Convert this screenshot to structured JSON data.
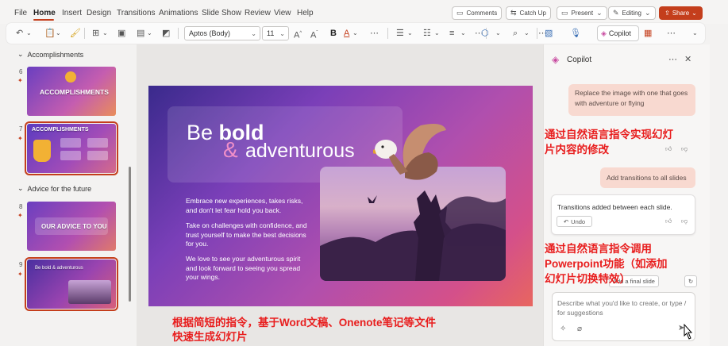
{
  "menu": [
    "File",
    "Home",
    "Insert",
    "Design",
    "Transitions",
    "Animations",
    "Slide Show",
    "Review",
    "View",
    "Help"
  ],
  "top_buttons": {
    "comments": "Comments",
    "catchup": "Catch Up",
    "present": "Present",
    "editing": "Editing",
    "share": "Share"
  },
  "toolbar": {
    "font_name": "Aptos (Body)",
    "font_size": "11",
    "copilot": "Copilot"
  },
  "thumbnails": {
    "section1": "Accomplishments",
    "section2": "Advice for the future",
    "slides": [
      {
        "num": "6",
        "title": "ACCOMPLISHMENTS"
      },
      {
        "num": "7",
        "title": "ACCOMPLISHMENTS"
      },
      {
        "num": "8",
        "title": "OUR ADVICE TO YOU"
      },
      {
        "num": "9",
        "title": "Be bold & adventurous"
      }
    ]
  },
  "slide": {
    "line1_plain": "Be ",
    "line1_bold": "bold",
    "amp": "&",
    "line2": "adventurous",
    "para1": "Embrace new experiences, takes risks, and don't let fear hold you back.",
    "para2": "Take on challenges with confidence, and trust yourself to make the best decisions for you.",
    "para3": "We love to see your adventurous spirit and look forward to seeing you spread your wings."
  },
  "copilot": {
    "title": "Copilot",
    "bubble1": "Replace the image with one that goes with adventure or flying",
    "bubble2": "Add transitions to all slides",
    "response": "Transitions added between each slide.",
    "undo": "Undo",
    "chip1": "Add a final slide",
    "input_placeholder": "Describe what you'd like to create, or type / for suggestions"
  },
  "annotations": {
    "a1": "通过自然语言指令实现幻灯片内容的修改",
    "a1_line1": "通过自然语言指令实现幻灯",
    "a1_line2": "片内容的修改",
    "a2_line1": "通过自然语言指令调用",
    "a2_line2": "Powerpoint功能（如添加",
    "a2_line3": "幻灯片切换特效）",
    "a3_line1": "根据简短的指令，基于Word文稿、Onenote笔记等文件",
    "a3_line2": "快速生成幻灯片"
  },
  "colors": {
    "accent": "#c43e1c",
    "annotation": "#e81d1d"
  }
}
